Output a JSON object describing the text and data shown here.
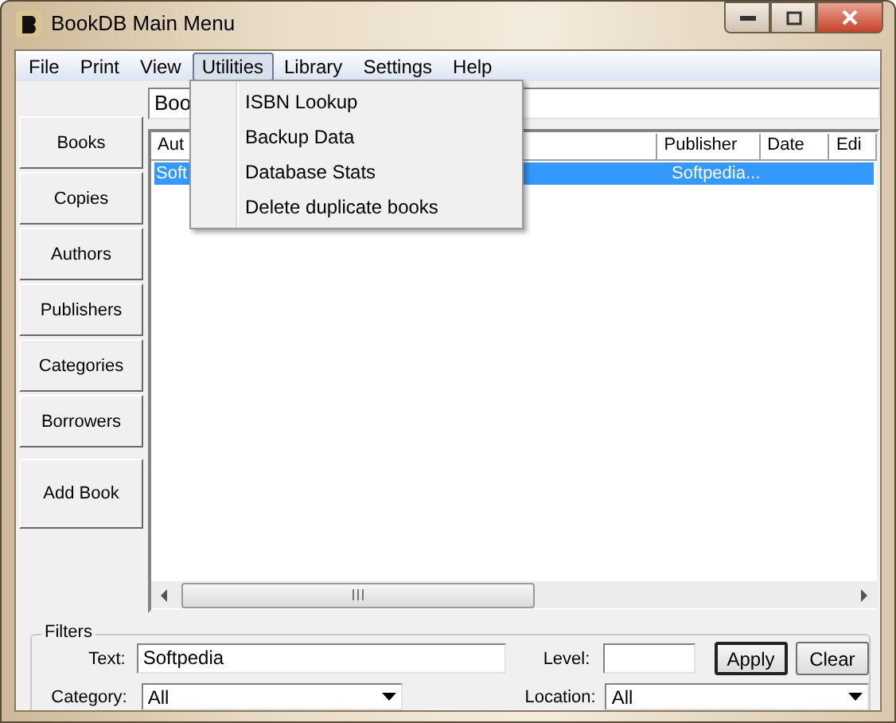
{
  "window": {
    "title": "BookDB Main Menu"
  },
  "menu": [
    {
      "label": "File",
      "open": false
    },
    {
      "label": "Print",
      "open": false
    },
    {
      "label": "View",
      "open": false
    },
    {
      "label": "Utilities",
      "open": true
    },
    {
      "label": "Library",
      "open": false
    },
    {
      "label": "Settings",
      "open": false
    },
    {
      "label": "Help",
      "open": false
    }
  ],
  "dropdown": [
    "ISBN Lookup",
    "Backup Data",
    "Database Stats",
    "Delete duplicate books"
  ],
  "sidebar": {
    "buttons": [
      "Books",
      "Copies",
      "Authors",
      "Publishers",
      "Categories",
      "Borrowers",
      "Add Book"
    ]
  },
  "search": {
    "value": "Boo"
  },
  "table": {
    "columns": [
      "Aut",
      "Publisher",
      "Date",
      "Edi"
    ],
    "rows": [
      {
        "selected": true,
        "author": "Soft",
        "publisher": "Softpedia..."
      }
    ]
  },
  "filters": {
    "title": "Filters",
    "text_label": "Text:",
    "text_value": "Softpedia",
    "level_label": "Level:",
    "buttons": [
      {
        "label": "Apply",
        "default": true
      },
      {
        "label": "Clear",
        "default": false
      }
    ],
    "category_label": "Category:",
    "category_value": "All",
    "location_label": "Location:",
    "location_value": "All"
  }
}
